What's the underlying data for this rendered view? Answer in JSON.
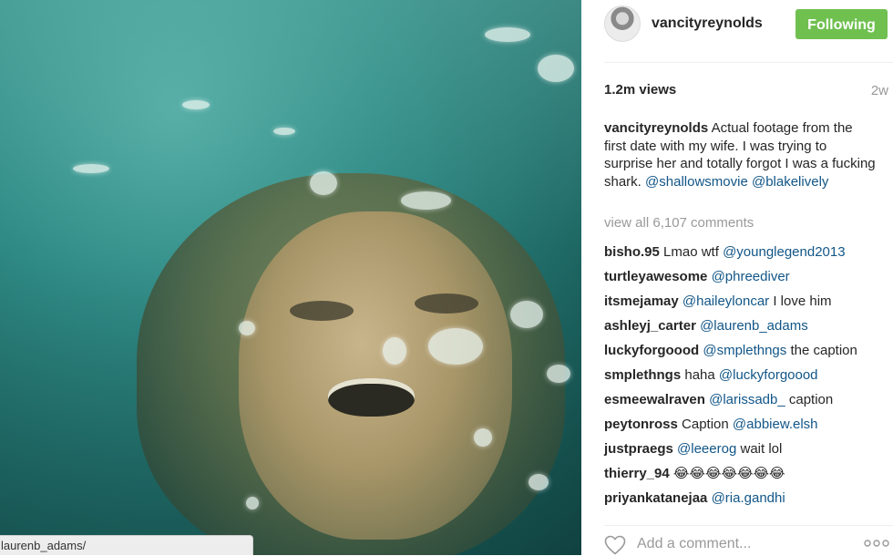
{
  "tooltip": {
    "url": "laurenb_adams/"
  },
  "header": {
    "username": "vancityreynolds",
    "follow_label": "Following",
    "follow_color": "#70c050"
  },
  "stats": {
    "views": "1.2m views",
    "age": "2w"
  },
  "caption": {
    "username": "vancityreynolds",
    "text": "Actual footage from the first date with my wife. I was trying to surprise her and totally forgot I was a fucking shark.",
    "mention1": "@shallowsmovie",
    "mention2": "@blakelively"
  },
  "view_all": "view all 6,107 comments",
  "comments": [
    {
      "user": "bisho.95",
      "pre": "Lmao wtf",
      "mention": "@younglegend2013",
      "post": ""
    },
    {
      "user": "turtleyawesome",
      "pre": "",
      "mention": "@phreediver",
      "post": ""
    },
    {
      "user": "itsmejamay",
      "pre": "",
      "mention": "@haileyloncar",
      "post": "I love him"
    },
    {
      "user": "ashleyj_carter",
      "pre": "",
      "mention": "@laurenb_adams",
      "post": ""
    },
    {
      "user": "luckyforgoood",
      "pre": "",
      "mention": "@smplethngs",
      "post": "the caption"
    },
    {
      "user": "smplethngs",
      "pre": "haha",
      "mention": "@luckyforgoood",
      "post": ""
    },
    {
      "user": "esmeewalraven",
      "pre": "",
      "mention": "@larissadb_",
      "post": "caption"
    },
    {
      "user": "peytonross",
      "pre": "Caption",
      "mention": "@abbiew.elsh",
      "post": ""
    },
    {
      "user": "justpraegs",
      "pre": "",
      "mention": "@leeerog",
      "post": "wait lol"
    },
    {
      "user": "thierry_94",
      "pre": "😂😂😂😂😂😂😂",
      "mention": "",
      "post": ""
    },
    {
      "user": "priyankatanejaa",
      "pre": "",
      "mention": "@ria.gandhi",
      "post": ""
    }
  ],
  "footer": {
    "placeholder": "Add a comment...",
    "like_icon": "heart-outline-icon",
    "more_icon": "more-options-icon"
  },
  "colors": {
    "mention": "#125688",
    "muted": "#999999",
    "text": "#262626"
  }
}
